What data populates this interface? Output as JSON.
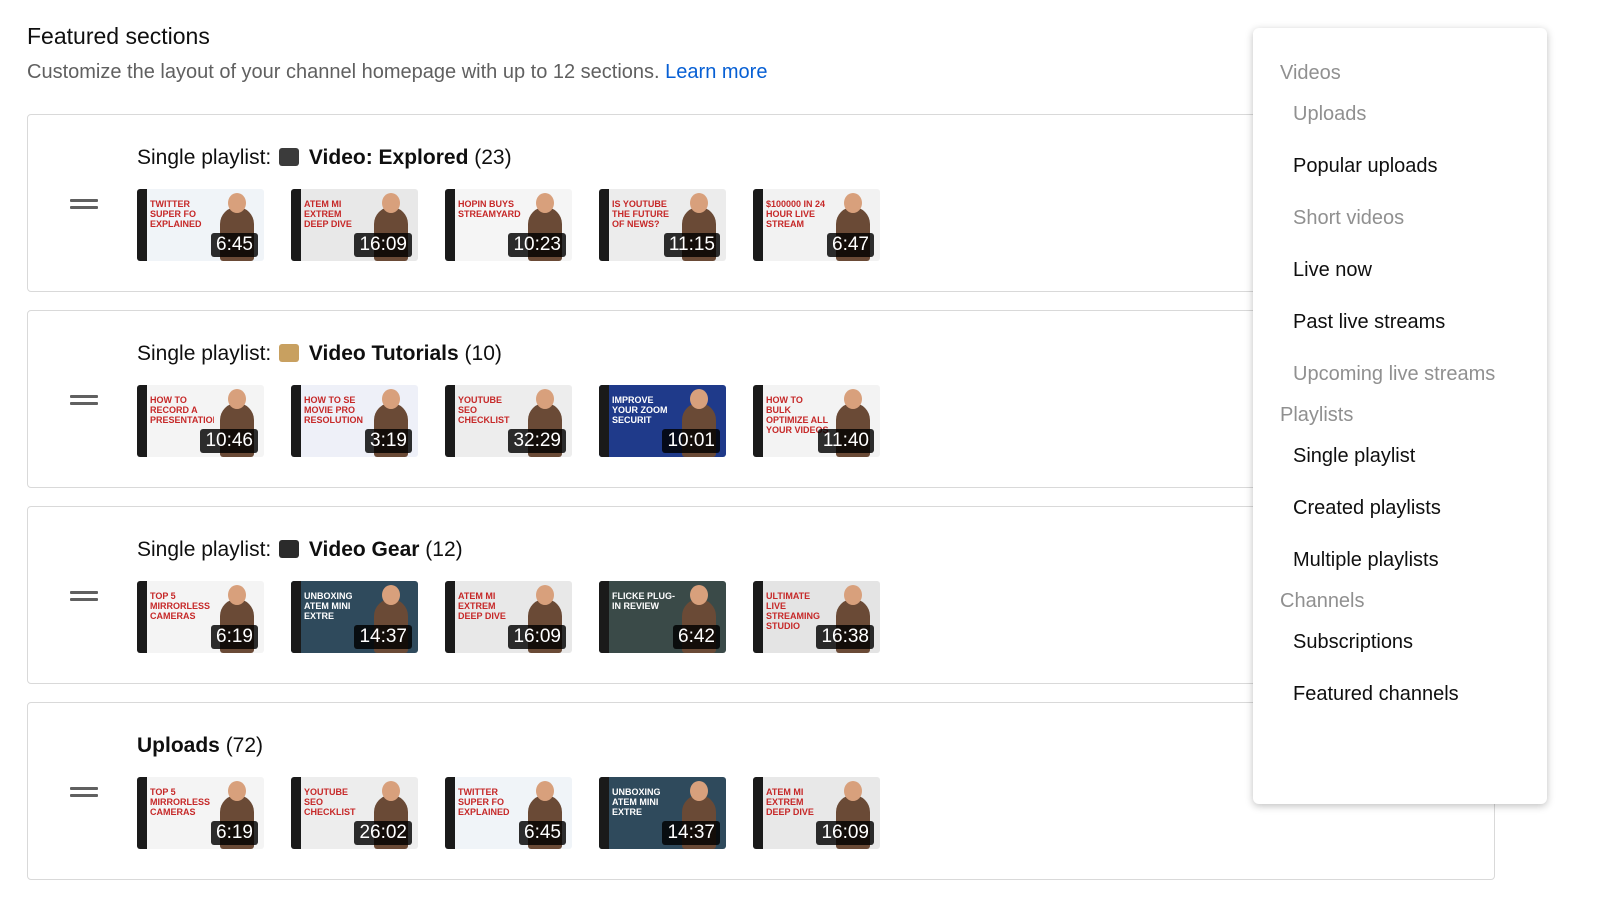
{
  "header": {
    "title": "Featured sections",
    "subtitle": "Customize the layout of your channel homepage with up to 12 sections.",
    "learn_more": "Learn more"
  },
  "sections": [
    {
      "prefix": "Single playlist:",
      "emoji_icon": "tv-icon",
      "name": "Video: Explored",
      "count": "(23)",
      "thumbs": [
        {
          "duration": "6:45",
          "caption": "TWITTER SUPER FO EXPLAINED",
          "bg": "#f0f4f8"
        },
        {
          "duration": "16:09",
          "caption": "ATEM MI EXTREM DEEP DIVE",
          "bg": "#e8e8e8"
        },
        {
          "duration": "10:23",
          "caption": "HOPIN BUYS STREAMYARD",
          "bg": "#f5f5f5"
        },
        {
          "duration": "11:15",
          "caption": "IS YOUTUBE THE FUTURE OF NEWS?",
          "bg": "#ececec"
        },
        {
          "duration": "6:47",
          "caption": "$100000 IN 24 HOUR LIVE STREAM",
          "bg": "#f2f2f2"
        }
      ]
    },
    {
      "prefix": "Single playlist:",
      "emoji_icon": "clipboard-icon",
      "name": "Video Tutorials",
      "count": "(10)",
      "thumbs": [
        {
          "duration": "10:46",
          "caption": "HOW TO RECORD A PRESENTATION",
          "bg": "#f4f4f4"
        },
        {
          "duration": "3:19",
          "caption": "HOW TO SE MOVIE PRO RESOLUTION",
          "bg": "#eef0f8"
        },
        {
          "duration": "32:29",
          "caption": "YOUTUBE SEO CHECKLIST",
          "bg": "#ededed"
        },
        {
          "duration": "10:01",
          "caption": "IMPROVE YOUR ZOOM SECURIT",
          "bg": "#1f3a8a"
        },
        {
          "duration": "11:40",
          "caption": "HOW TO BULK OPTIMIZE ALL YOUR VIDEOS SEO",
          "bg": "#f3f3f3"
        }
      ]
    },
    {
      "prefix": "Single playlist:",
      "emoji_icon": "video-camera-icon",
      "name": "Video Gear",
      "count": "(12)",
      "thumbs": [
        {
          "duration": "6:19",
          "caption": "TOP 5 MIRRORLESS CAMERAS",
          "bg": "#f4f4f4"
        },
        {
          "duration": "14:37",
          "caption": "UNBOXING ATEM MINI EXTRE",
          "bg": "#2f4a5c"
        },
        {
          "duration": "16:09",
          "caption": "ATEM MI EXTREM DEEP DIVE",
          "bg": "#e8e8e8"
        },
        {
          "duration": "6:42",
          "caption": "FLICKE PLUG-IN REVIEW",
          "bg": "#3a4a48"
        },
        {
          "duration": "16:38",
          "caption": "ULTIMATE LIVE STREAMING STUDIO SETUP",
          "bg": "#e4e4e4"
        }
      ]
    },
    {
      "prefix": "",
      "emoji_icon": "",
      "name": "Uploads",
      "count": "(72)",
      "thumbs": [
        {
          "duration": "6:19",
          "caption": "TOP 5 MIRRORLESS CAMERAS",
          "bg": "#f4f4f4"
        },
        {
          "duration": "26:02",
          "caption": "YOUTUBE SEO CHECKLIST",
          "bg": "#ededed"
        },
        {
          "duration": "6:45",
          "caption": "TWITTER SUPER FO EXPLAINED",
          "bg": "#f0f4f8"
        },
        {
          "duration": "14:37",
          "caption": "UNBOXING ATEM MINI EXTRE",
          "bg": "#2f4a5c"
        },
        {
          "duration": "16:09",
          "caption": "ATEM MI EXTREM DEEP DIVE",
          "bg": "#e8e8e8"
        }
      ]
    }
  ],
  "menu": [
    {
      "type": "group",
      "label": "Videos"
    },
    {
      "type": "item",
      "label": "Uploads",
      "disabled": true
    },
    {
      "type": "item",
      "label": "Popular uploads",
      "disabled": false
    },
    {
      "type": "item",
      "label": "Short videos",
      "disabled": true
    },
    {
      "type": "item",
      "label": "Live now",
      "disabled": false
    },
    {
      "type": "item",
      "label": "Past live streams",
      "disabled": false
    },
    {
      "type": "item",
      "label": "Upcoming live streams",
      "disabled": true
    },
    {
      "type": "group",
      "label": "Playlists"
    },
    {
      "type": "item",
      "label": "Single playlist",
      "disabled": false
    },
    {
      "type": "item",
      "label": "Created playlists",
      "disabled": false
    },
    {
      "type": "item",
      "label": "Multiple playlists",
      "disabled": false
    },
    {
      "type": "group",
      "label": "Channels"
    },
    {
      "type": "item",
      "label": "Subscriptions",
      "disabled": false
    },
    {
      "type": "item",
      "label": "Featured channels",
      "disabled": false
    }
  ],
  "colors": {
    "link": "#065fd4",
    "disabled_text": "#909090",
    "duration_bg": "#000000"
  }
}
